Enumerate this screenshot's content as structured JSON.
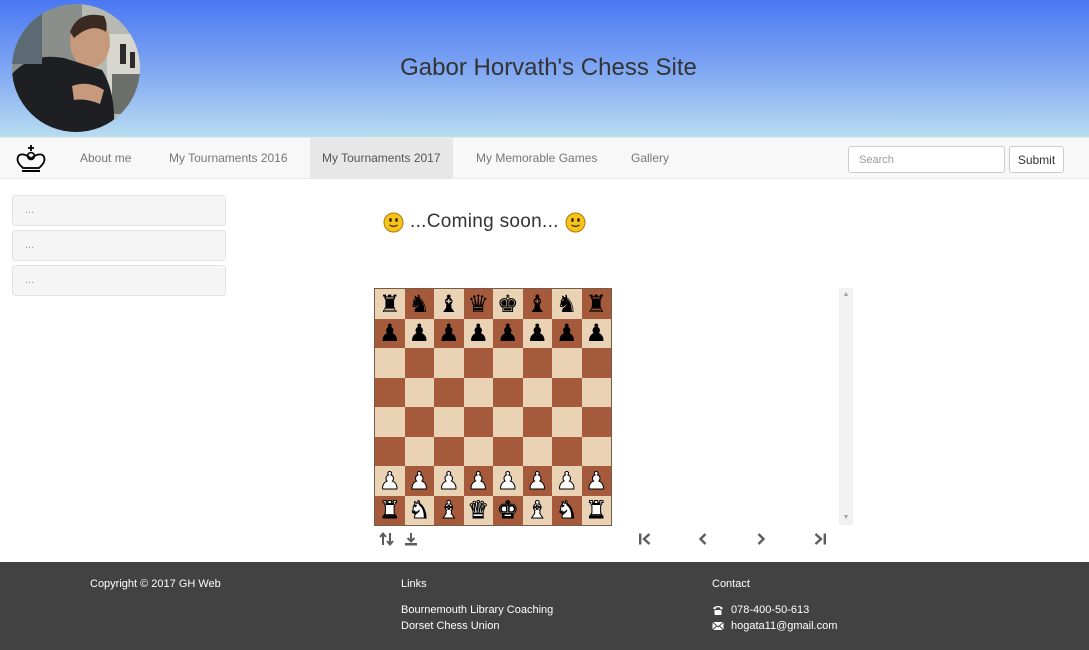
{
  "header": {
    "title": "Gabor Horvath's Chess Site"
  },
  "nav": {
    "brand_icon": "king-icon",
    "items": [
      {
        "label": "About me"
      },
      {
        "label": "My Tournaments 2016"
      },
      {
        "label": "My Tournaments 2017",
        "active": true
      },
      {
        "label": "My Memorable Games"
      },
      {
        "label": "Gallery"
      }
    ],
    "search_placeholder": "Search",
    "submit_label": "Submit"
  },
  "sidebar": {
    "items": [
      {
        "label": "..."
      },
      {
        "label": "..."
      },
      {
        "label": "..."
      }
    ]
  },
  "main": {
    "message": "...Coming soon...",
    "board": {
      "position": [
        [
          "r",
          "n",
          "b",
          "q",
          "k",
          "b",
          "n",
          "r"
        ],
        [
          "p",
          "p",
          "p",
          "p",
          "p",
          "p",
          "p",
          "p"
        ],
        [
          "",
          "",
          "",
          "",
          "",
          "",
          "",
          ""
        ],
        [
          "",
          "",
          "",
          "",
          "",
          "",
          "",
          ""
        ],
        [
          "",
          "",
          "",
          "",
          "",
          "",
          "",
          ""
        ],
        [
          "",
          "",
          "",
          "",
          "",
          "",
          "",
          ""
        ],
        [
          "P",
          "P",
          "P",
          "P",
          "P",
          "P",
          "P",
          "P"
        ],
        [
          "R",
          "N",
          "B",
          "Q",
          "K",
          "B",
          "N",
          "R"
        ]
      ],
      "light_color": "#ead3b4",
      "dark_color": "#a65a3c"
    },
    "controls": [
      "flip-icon",
      "download-icon",
      "first-move-icon",
      "previous-move-icon",
      "next-move-icon",
      "last-move-icon"
    ]
  },
  "footer": {
    "copyright": "Copyright © 2017 GH Web",
    "links_heading": "Links",
    "links": [
      "Bournemouth Library Coaching",
      "Dorset Chess Union"
    ],
    "contact_heading": "Contact",
    "phone": "078-400-50-613",
    "email": "hogata11@gmail.com",
    "background": "#424242"
  }
}
